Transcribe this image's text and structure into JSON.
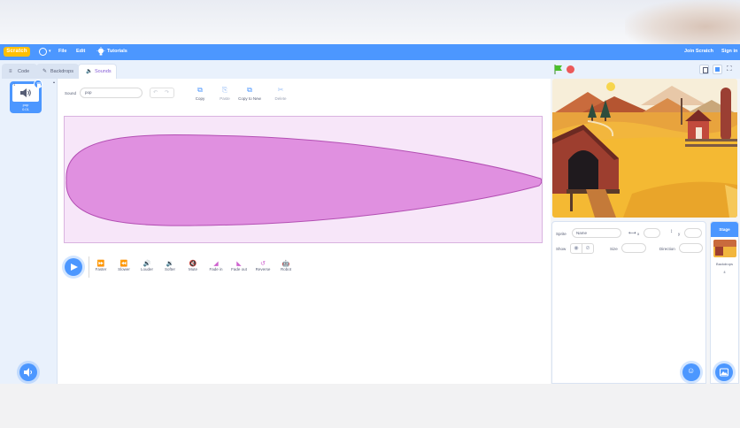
{
  "menu": {
    "logo": "Scratch",
    "file": "File",
    "edit": "Edit",
    "tutorials": "Tutorials",
    "join": "Join Scratch",
    "signin": "Sign in"
  },
  "tabs": {
    "code": "Code",
    "backdrops": "Backdrops",
    "sounds": "Sounds"
  },
  "sound_tile": {
    "number": "1",
    "name": "pop",
    "duration": "0.01"
  },
  "editor": {
    "sound_label": "Sound",
    "sound_name": "pop",
    "copy": "Copy",
    "paste": "Paste",
    "copy_to_new": "Copy to New",
    "delete": "Delete"
  },
  "effects": [
    "Faster",
    "Slower",
    "Louder",
    "Softer",
    "Mute",
    "Fade in",
    "Fade out",
    "Reverse",
    "Robot"
  ],
  "sprite_info": {
    "sprite_label": "Sprite",
    "sprite_name": "Name",
    "x_label": "x",
    "y_label": "y",
    "show_label": "Show",
    "size_label": "Size",
    "direction_label": "Direction"
  },
  "stage_panel": {
    "title": "Stage",
    "backdrops_label": "Backdrops",
    "backdrops_count": "4"
  },
  "colors": {
    "accent": "#4c97ff",
    "purple": "#855cd6",
    "wave": "#cf63cf",
    "sound_fill": "#e090e0"
  },
  "icons": [
    "globe-icon",
    "lightbulb-icon",
    "green-flag-icon",
    "stop-icon",
    "speaker-icon",
    "trash-icon",
    "play-icon",
    "scissors-icon",
    "cat-icon"
  ]
}
